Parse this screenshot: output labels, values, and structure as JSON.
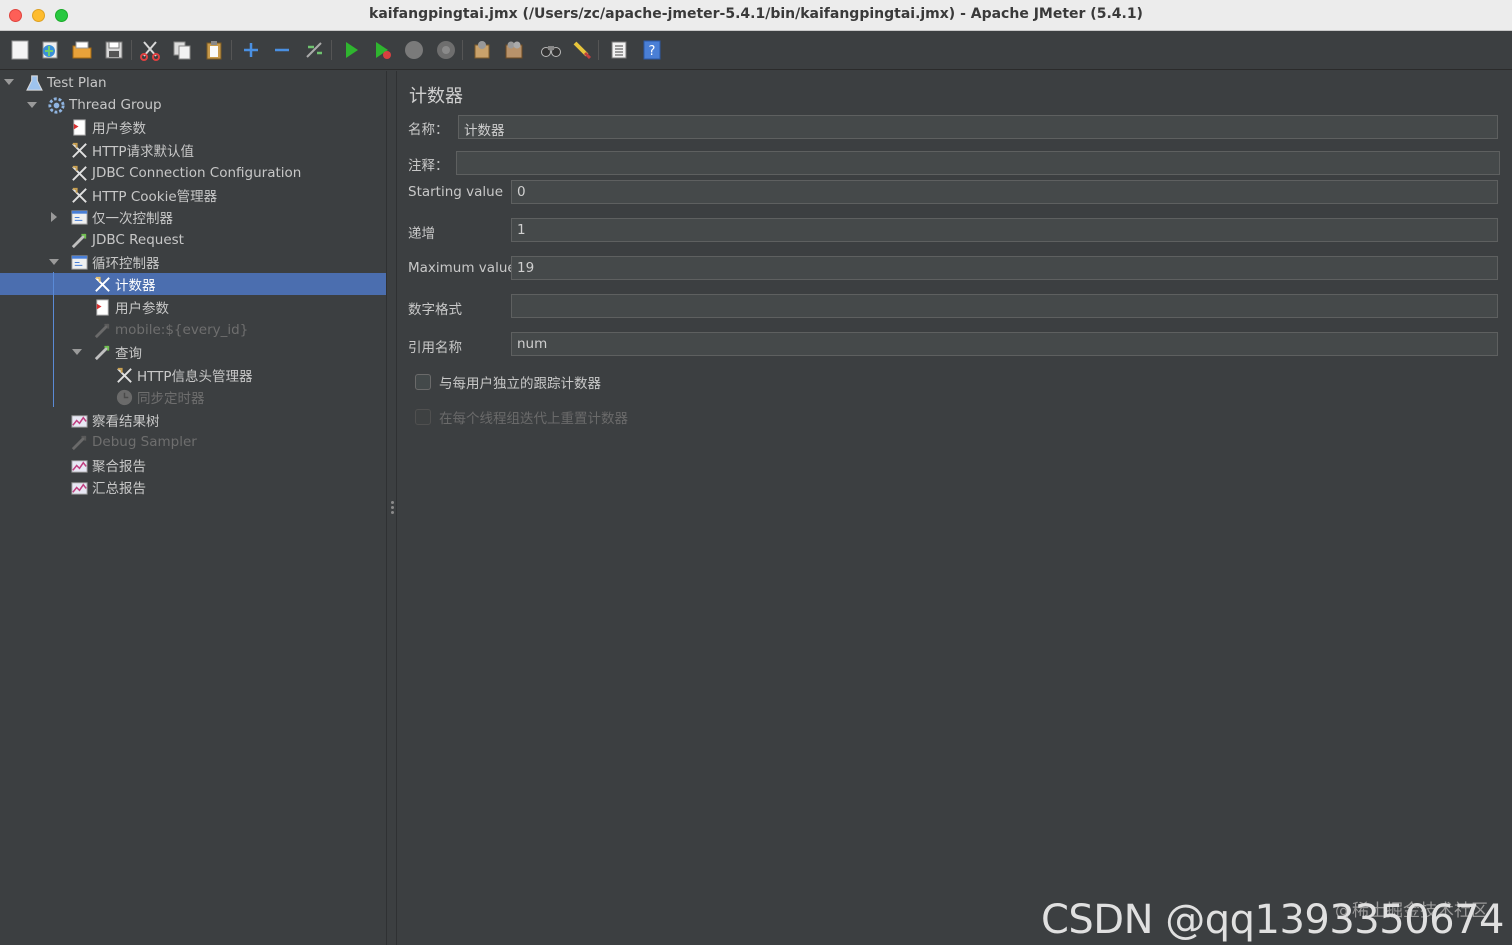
{
  "window": {
    "title": "kaifangpingtai.jmx (/Users/zc/apache-jmeter-5.4.1/bin/kaifangpingtai.jmx) - Apache JMeter (5.4.1)"
  },
  "toolbar": {
    "buttons": [
      "new-icon",
      "templates-icon",
      "open-icon",
      "save-icon",
      "cut-icon",
      "copy-icon",
      "paste-icon",
      "expand-icon",
      "collapse-icon",
      "toggle-icon",
      "start-icon",
      "start-no-pause-icon",
      "stop-icon",
      "shutdown-icon",
      "clear-icon",
      "clear-all-icon",
      "search-icon",
      "reset-search-icon",
      "function-helper-icon",
      "help-icon"
    ]
  },
  "tree": {
    "nodes": [
      {
        "label": "Test Plan",
        "icon": "flask-icon",
        "disabled": false
      },
      {
        "label": "Thread Group",
        "icon": "gear-icon",
        "disabled": false
      },
      {
        "label": "用户参数",
        "icon": "preprocessor-icon",
        "disabled": false
      },
      {
        "label": "HTTP请求默认值",
        "icon": "config-icon",
        "disabled": false
      },
      {
        "label": "JDBC Connection Configuration",
        "icon": "config-icon",
        "disabled": false
      },
      {
        "label": "HTTP Cookie管理器",
        "icon": "config-icon",
        "disabled": false
      },
      {
        "label": "仅一次控制器",
        "icon": "controller-icon",
        "disabled": false
      },
      {
        "label": "JDBC Request",
        "icon": "sampler-icon",
        "disabled": false
      },
      {
        "label": "循环控制器",
        "icon": "controller-icon",
        "disabled": false
      },
      {
        "label": "计数器",
        "icon": "config-icon",
        "disabled": false
      },
      {
        "label": "用户参数",
        "icon": "preprocessor-icon",
        "disabled": false
      },
      {
        "label": "mobile:${every_id}",
        "icon": "sampler-icon",
        "disabled": true
      },
      {
        "label": "查询",
        "icon": "sampler-icon",
        "disabled": false
      },
      {
        "label": "HTTP信息头管理器",
        "icon": "config-icon",
        "disabled": false
      },
      {
        "label": "同步定时器",
        "icon": "timer-icon",
        "disabled": true
      },
      {
        "label": "察看结果树",
        "icon": "listener-icon",
        "disabled": false
      },
      {
        "label": "Debug Sampler",
        "icon": "sampler-icon",
        "disabled": true
      },
      {
        "label": "聚合报告",
        "icon": "listener-icon",
        "disabled": false
      },
      {
        "label": "汇总报告",
        "icon": "listener-icon",
        "disabled": false
      }
    ]
  },
  "counter": {
    "title": "计数器",
    "name_label": "名称：",
    "name_value": "计数器",
    "comment_label": "注释：",
    "comment_value": "",
    "start_label": "Starting value",
    "start_value": "0",
    "increment_label": "递增",
    "increment_value": "1",
    "max_label": "Maximum value",
    "max_value": "19",
    "format_label": "数字格式",
    "format_value": "",
    "refname_label": "引用名称",
    "refname_value": "num",
    "per_user_label": "与每用户独立的跟踪计数器",
    "reset_label": "在每个线程组迭代上重置计数器"
  },
  "watermark": {
    "main": "CSDN @qq1393350674",
    "sub": "@稀土掘金技术社区"
  }
}
